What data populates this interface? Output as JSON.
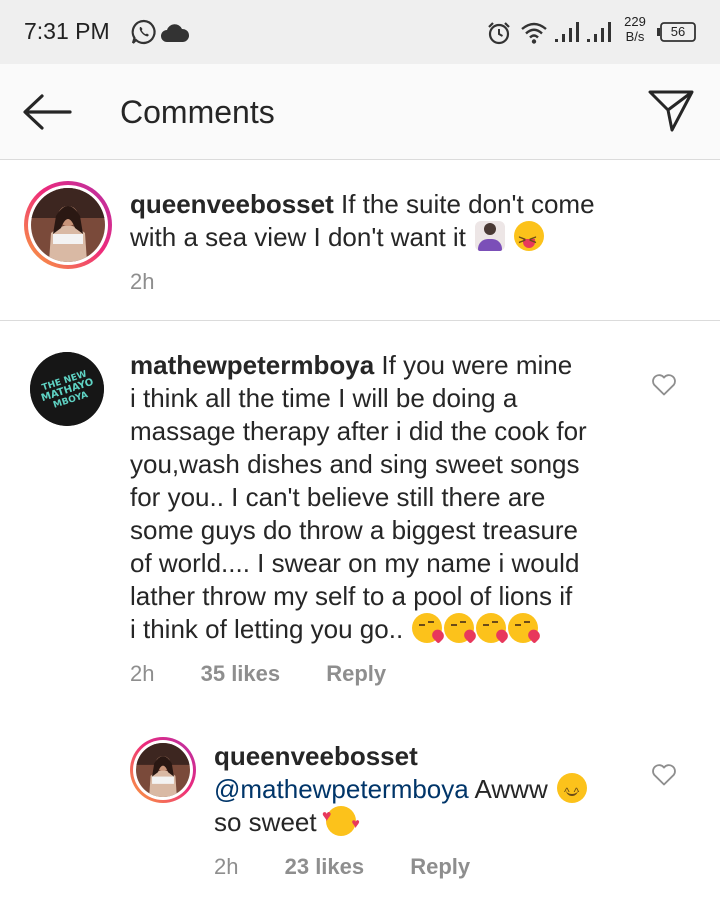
{
  "status_bar": {
    "time": "7:31 PM",
    "net_speed_value": "229",
    "net_speed_unit": "B/s",
    "battery": "56",
    "icons": [
      "whatsapp-icon",
      "cloud-icon",
      "alarm-icon",
      "wifi-icon",
      "signal-icon",
      "signal-icon",
      "battery-icon"
    ]
  },
  "header": {
    "title": "Comments",
    "back_icon": "arrow-left-icon",
    "dm_icon": "paper-plane-icon"
  },
  "comments": [
    {
      "username": "queenveebosset",
      "text_line1": "If the suite don't come",
      "text_line2": "with a sea view I don't want it",
      "emojis": [
        "person-shrugging",
        "squinting-face-with-tongue"
      ],
      "time": "2h"
    },
    {
      "username": "mathewpetermboya",
      "avatar_text": "THE NEW MATHAYO MBOYA",
      "lines": [
        "If you were mine",
        "i think all the time I will be doing a",
        "massage therapy after i did the cook for",
        "you,wash dishes and sing sweet songs",
        "for you.. I can't believe still there are",
        "some guys do throw a biggest treasure",
        "of world.... I swear on my name i would",
        "lather throw my self to a pool of lions if",
        "i think of letting you go.."
      ],
      "emojis": [
        "face-blowing-kiss",
        "face-blowing-kiss",
        "face-blowing-kiss",
        "face-blowing-kiss"
      ],
      "time": "2h",
      "likes": "35 likes",
      "reply": "Reply"
    },
    {
      "username": "queenveebosset",
      "mention": "@mathewpetermboya",
      "text_after_mention": "Awww",
      "text_line2": "so sweet",
      "emojis": [
        "smiling-face-with-smiling-eyes",
        "smiling-face-with-hearts"
      ],
      "time": "2h",
      "likes": "23 likes",
      "reply": "Reply"
    }
  ],
  "colors": {
    "status_bar_bg": "#efefef",
    "header_bg": "#fafafa",
    "text": "#262626",
    "meta": "#8e8e8e",
    "mention": "#003569",
    "divider": "#dbdbdb"
  }
}
